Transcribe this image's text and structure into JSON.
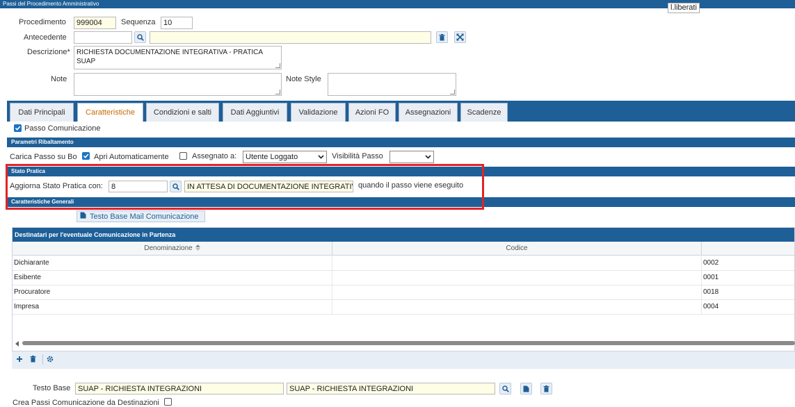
{
  "window": {
    "title": "Passi del Procedimento Amministrativo",
    "tooltip": "l.liberati"
  },
  "form": {
    "procedimento_label": "Procedimento",
    "procedimento_value": "999004",
    "sequenza_label": "Sequenza",
    "sequenza_value": "10",
    "antecedente_label": "Antecedente",
    "antecedente_value": "",
    "antecedente_desc": "",
    "descrizione_label": "Descrizione*",
    "descrizione_value": "RICHIESTA DOCUMENTAZIONE INTEGRATIVA - PRATICA SUAP",
    "note_label": "Note",
    "note_value": "",
    "note_style_label": "Note Style",
    "note_style_value": ""
  },
  "tabs": [
    {
      "label": "Dati Principali",
      "active": false
    },
    {
      "label": "Caratteristiche",
      "active": true
    },
    {
      "label": "Condizioni e salti",
      "active": false
    },
    {
      "label": "Dati Aggiuntivi",
      "active": false
    },
    {
      "label": "Validazione",
      "active": false
    },
    {
      "label": "Azioni FO",
      "active": false
    },
    {
      "label": "Assegnazioni",
      "active": false
    },
    {
      "label": "Scadenze",
      "active": false
    }
  ],
  "passo_comunicazione": {
    "label": "Passo Comunicazione",
    "checked": true
  },
  "parametri": {
    "title": "Parametri Ribaltamento",
    "carica_label": "Carica Passo su Bo",
    "apri_label": "Apri Automaticamente",
    "apri_checked": true,
    "assegnato_label": "Assegnato a:",
    "assegnato_checked": false,
    "assegnato_value": "Utente Loggato",
    "visibilita_label": "Visibilità Passo",
    "visibilita_value": ""
  },
  "stato_pratica": {
    "title": "Stato Pratica",
    "aggiorna_label": "Aggiorna Stato Pratica con:",
    "code": "8",
    "description": "IN ATTESA DI DOCUMENTAZIONE INTEGRATIVA",
    "suffix": "quando il passo viene eseguito"
  },
  "caratteristiche_generali": {
    "title": "Caratteristiche Generali",
    "testo_base_button": "Testo Base Mail Comunicazione"
  },
  "destinatari": {
    "title": "Destinatari per l'eventuale Comunicazione in Partenza",
    "columns": [
      "Denominazione",
      "Codice"
    ],
    "rows": [
      {
        "denominazione": "Dichiarante",
        "codice": "",
        "extra": "0002"
      },
      {
        "denominazione": "Esibente",
        "codice": "",
        "extra": "0001"
      },
      {
        "denominazione": "Procuratore",
        "codice": "",
        "extra": "0018"
      },
      {
        "denominazione": "Impresa",
        "codice": "",
        "extra": "0004"
      }
    ]
  },
  "testo_base": {
    "label": "Testo Base",
    "value1": "SUAP - RICHIESTA INTEGRAZIONI",
    "value2": "SUAP - RICHIESTA INTEGRAZIONI"
  },
  "crea_passi": {
    "label": "Crea Passi Comunicazione da Destinazioni",
    "checked": false
  },
  "colors": {
    "accent": "#1e5f97",
    "highlight_box": "#e2232a",
    "active_tab_text": "#c66a00"
  }
}
